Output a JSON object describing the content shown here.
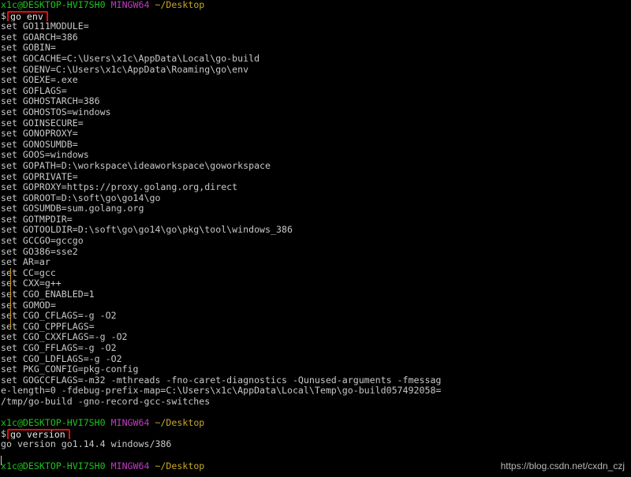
{
  "prompt1": {
    "user": "x1c@DESKTOP-HVI7SH0",
    "system": "MINGW64",
    "path": "~/Desktop",
    "symbol": "$",
    "command": "go env"
  },
  "env_lines": [
    "set GO111MODULE=",
    "set GOARCH=386",
    "set GOBIN=",
    "set GOCACHE=C:\\Users\\x1c\\AppData\\Local\\go-build",
    "set GOENV=C:\\Users\\x1c\\AppData\\Roaming\\go\\env",
    "set GOEXE=.exe",
    "set GOFLAGS=",
    "set GOHOSTARCH=386",
    "set GOHOSTOS=windows",
    "set GOINSECURE=",
    "set GONOPROXY=",
    "set GONOSUMDB=",
    "set GOOS=windows",
    "set GOPATH=D:\\workspace\\ideaworkspace\\goworkspace",
    "set GOPRIVATE=",
    "set GOPROXY=https://proxy.golang.org,direct",
    "set GOROOT=D:\\soft\\go\\go14\\go",
    "set GOSUMDB=sum.golang.org",
    "set GOTMPDIR=",
    "set GOTOOLDIR=D:\\soft\\go\\go14\\go\\pkg\\tool\\windows_386",
    "set GCCGO=gccgo",
    "set GO386=sse2",
    "set AR=ar",
    "set CC=gcc",
    "set CXX=g++",
    "set CGO_ENABLED=1",
    "set GOMOD=",
    "set CGO_CFLAGS=-g -O2",
    "set CGO_CPPFLAGS=",
    "set CGO_CXXFLAGS=-g -O2",
    "set CGO_FFLAGS=-g -O2",
    "set CGO_LDFLAGS=-g -O2",
    "set PKG_CONFIG=pkg-config",
    "set GOGCCFLAGS=-m32 -mthreads -fno-caret-diagnostics -Qunused-arguments -fmessag",
    "e-length=0 -fdebug-prefix-map=C:\\Users\\x1c\\AppData\\Local\\Temp\\go-build057492058=",
    "/tmp/go-build -gno-record-gcc-switches"
  ],
  "prompt2": {
    "user": "x1c@DESKTOP-HVI7SH0",
    "system": "MINGW64",
    "path": "~/Desktop",
    "symbol": "$",
    "command": "go version"
  },
  "version_output": "go version go1.14.4 windows/386",
  "prompt3": {
    "user": "x1c@DESKTOP-HVI7SH0",
    "system": "MINGW64",
    "path": "~/Desktop"
  },
  "watermark": "https://blog.csdn.net/cxdn_czj",
  "colors": {
    "background": "#000000",
    "text": "#c8c8c8",
    "user": "#1ec41e",
    "system": "#c23cc2",
    "path": "#c8a82a",
    "highlight_box": "#e01010"
  }
}
